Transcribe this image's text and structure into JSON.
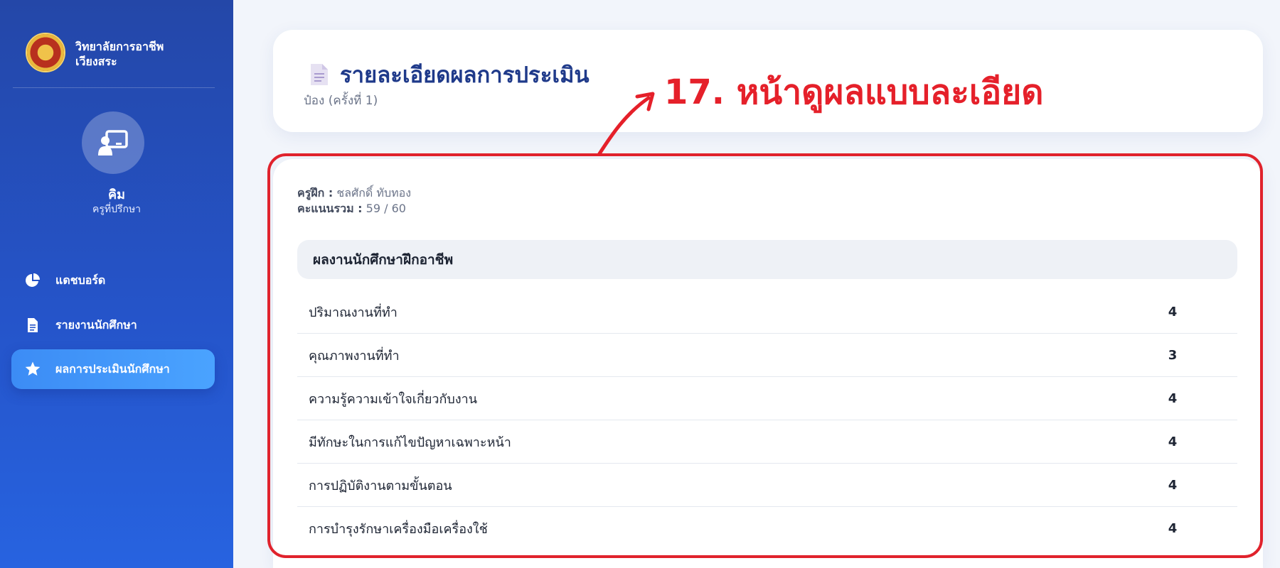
{
  "sidebar": {
    "brand": {
      "line1": "วิทยาลัยการอาชีพ",
      "line2": "เวียงสระ"
    },
    "profile": {
      "name": "คิม",
      "role": "ครูที่ปรึกษา"
    },
    "nav": [
      {
        "label": "แดชบอร์ด",
        "icon": "pie-chart-icon"
      },
      {
        "label": "รายงานนักศึกษา",
        "icon": "document-icon"
      },
      {
        "label": "ผลการประเมินนักศึกษา",
        "icon": "star-icon",
        "active": true
      }
    ]
  },
  "header": {
    "title": "รายละเอียดผลการประเมิน",
    "subtitle": "ป๋อง (ครั้งที่ 1)"
  },
  "annotation": {
    "text": "17. หน้าดูผลแบบละเอียด",
    "color": "#e5202a"
  },
  "detail": {
    "trainer_label": "ครูฝึก :",
    "trainer_value": "ชลศักดิ์ ทับทอง",
    "total_label": "คะแนนรวม :",
    "total_value": "59 / 60",
    "section_title": "ผลงานนักศึกษาฝึกอาชีพ",
    "rows": [
      {
        "label": "ปริมาณงานที่ทำ",
        "score": "4"
      },
      {
        "label": "คุณภาพงานที่ทำ",
        "score": "3"
      },
      {
        "label": "ความรู้ความเข้าใจเกี่ยวกับงาน",
        "score": "4"
      },
      {
        "label": "มีทักษะในการแก้ไขปัญหาเฉพาะหน้า",
        "score": "4"
      },
      {
        "label": "การปฏิบัติงานตามขั้นตอน",
        "score": "4"
      },
      {
        "label": "การบำรุงรักษาเครื่องมือเครื่องใช้",
        "score": "4"
      }
    ]
  },
  "colors": {
    "sidebar": "#2554c9",
    "accent": "#3c8cf5",
    "title": "#1f3a8a",
    "highlight": "#e0222c"
  }
}
